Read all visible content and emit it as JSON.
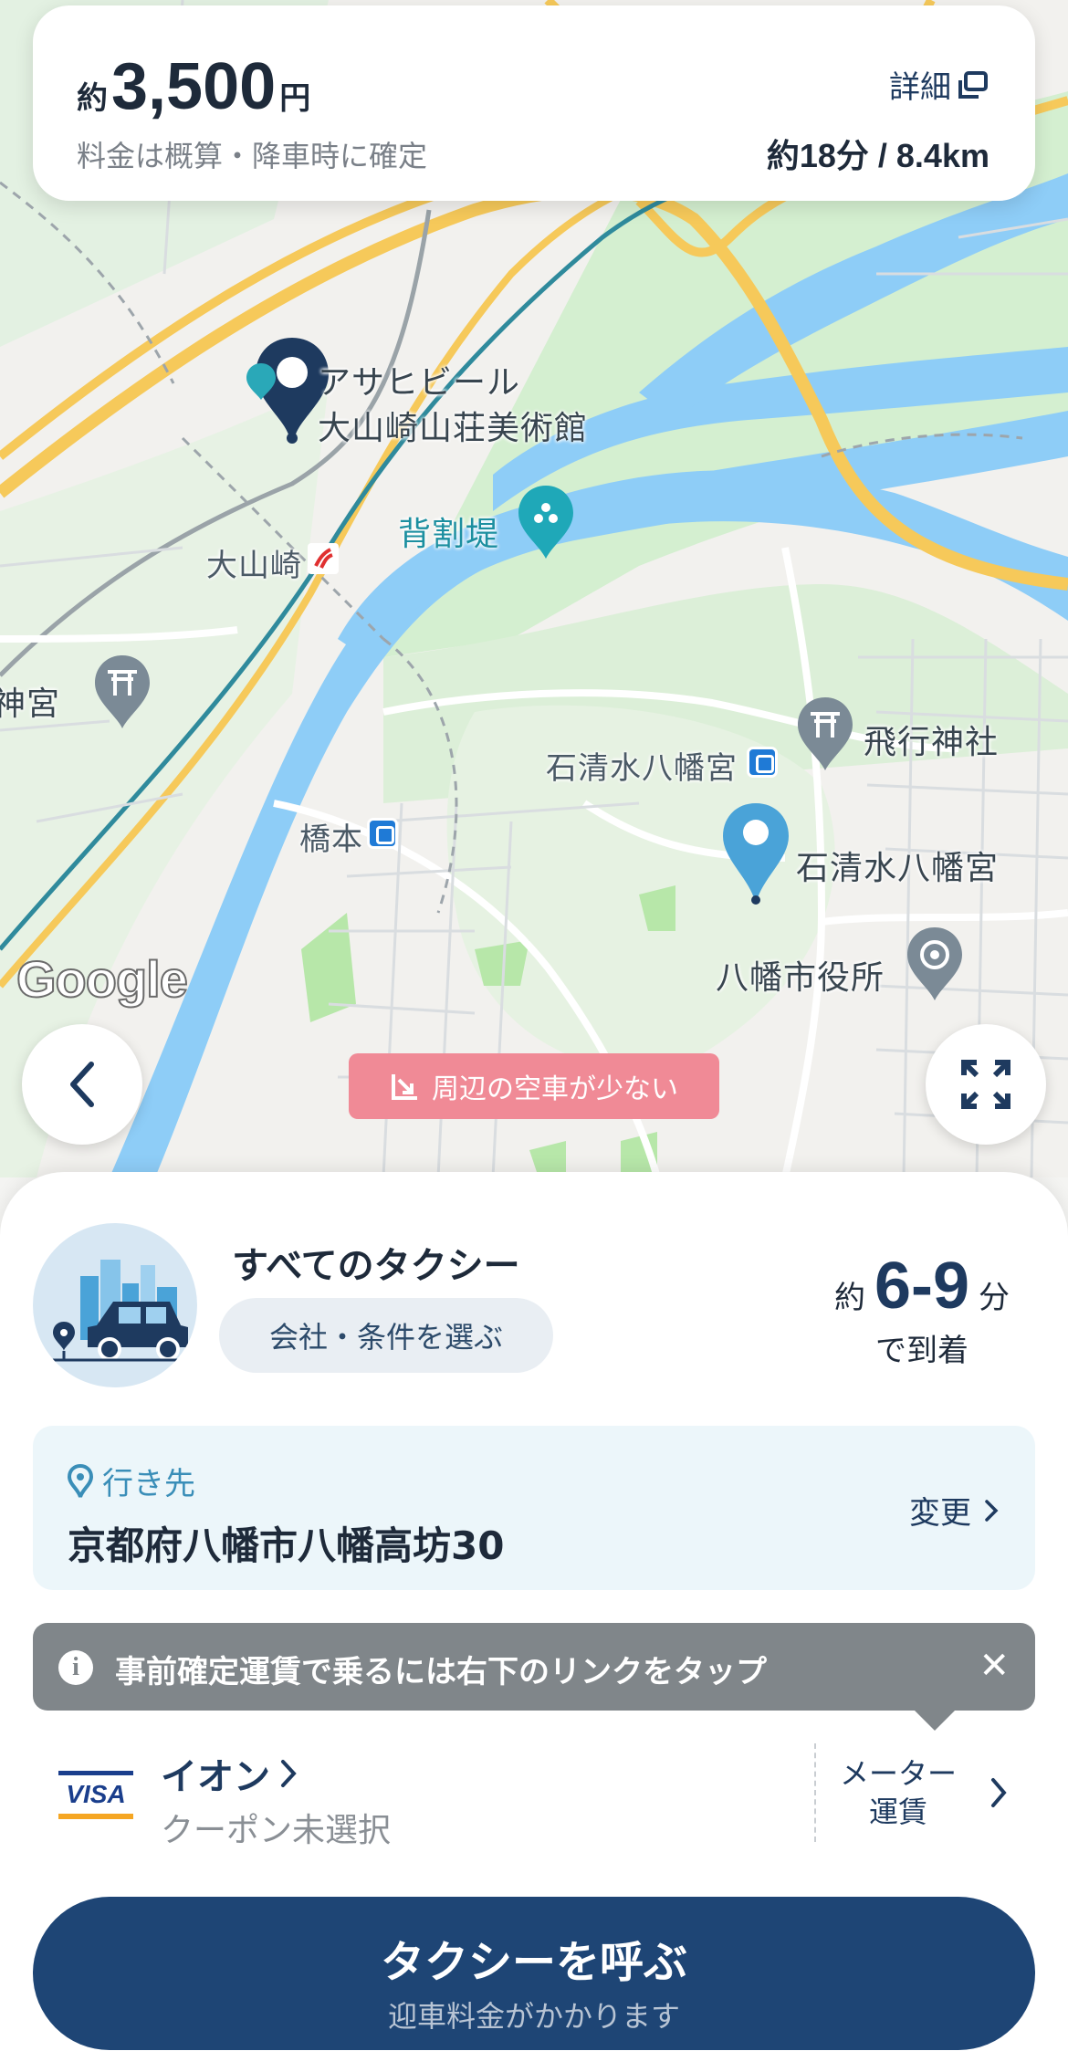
{
  "price": {
    "prefix": "約",
    "amount": "3,500",
    "unit": "円",
    "note": "料金は概算・降車時に確定",
    "detail_label": "詳細",
    "trip_info": "約18分 / 8.4km"
  },
  "map": {
    "labels": {
      "asahi_beer_line1": "アサヒビール",
      "asahi_beer_line2": "大山崎山荘美術館",
      "sewaritei": "背割堤",
      "oyamazaki": "大山崎",
      "jingu_left": "神宮",
      "hiko_jinja": "飛行神社",
      "iwashimizu_station": "石清水八幡宮",
      "hashimoto": "橋本",
      "iwashimizu_shrine": "石清水八幡宮",
      "yawata_city_hall": "八幡市役所"
    },
    "google_logo": "Google",
    "availability_alert": "周辺の空車が少ない",
    "colors": {
      "water": "#8ecdf7",
      "park": "#d4efd0",
      "highway": "#f6c95a",
      "rail": "#2f8a9c",
      "pin_dark": "#1e3a5f",
      "pin_blue": "#4aa3d8"
    }
  },
  "taxi": {
    "title": "すべてのタクシー",
    "company_button": "会社・条件を選ぶ",
    "eta_prefix": "約",
    "eta_value": "6-9",
    "eta_unit": "分",
    "eta_suffix": "で到着"
  },
  "destination": {
    "label": "行き先",
    "value": "京都府八幡市八幡高坊30",
    "change": "変更"
  },
  "tooltip": {
    "text": "事前確定運賃で乗るには右下のリンクをタップ",
    "close": "✕"
  },
  "payment": {
    "card_brand": "VISA",
    "card_name": "イオン",
    "coupon": "クーポン未選択",
    "meter_line1": "メーター",
    "meter_line2": "運賃"
  },
  "call": {
    "main": "タクシーを呼ぶ",
    "sub": "迎車料金がかかります"
  }
}
